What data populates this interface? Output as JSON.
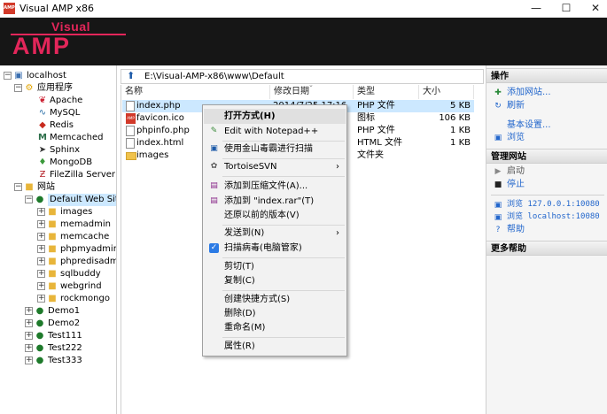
{
  "window": {
    "title": "Visual AMP x86",
    "app_icon_text": "AMP",
    "min": "—",
    "max": "☐",
    "close": "✕"
  },
  "banner": {
    "logo_top": "Visual",
    "logo_main": "AMP"
  },
  "tree": {
    "root": "localhost",
    "apps_label": "应用程序",
    "apps": [
      "Apache",
      "MySQL",
      "Redis",
      "Memcached",
      "Sphinx",
      "MongoDB",
      "FileZilla Server"
    ],
    "sites_label": "网站",
    "default_site": "Default Web Site",
    "default_children": [
      "images",
      "memadmin",
      "memcache",
      "phpmyadmin",
      "phpredisadmin",
      "sqlbuddy",
      "webgrind",
      "rockmongo"
    ],
    "other_sites": [
      "Demo1",
      "Demo2",
      "Test111",
      "Test222",
      "Test333"
    ]
  },
  "path": {
    "value": "E:\\Visual-AMP-x86\\www\\Default"
  },
  "columns": {
    "name": "名称",
    "modified": "修改日期",
    "type": "类型",
    "size": "大小"
  },
  "files": [
    {
      "name": "index.php",
      "date": "2014/7/25 17:16",
      "type": "PHP 文件",
      "size": "5 KB"
    },
    {
      "name": "favicon.ico",
      "date": "",
      "type": "图标",
      "size": "106 KB"
    },
    {
      "name": "phpinfo.php",
      "date": "",
      "type": "PHP 文件",
      "size": "1 KB"
    },
    {
      "name": "index.html",
      "date": "",
      "type": "HTML 文件",
      "size": "1 KB"
    },
    {
      "name": "images",
      "date": "",
      "type": "文件夹",
      "size": ""
    }
  ],
  "context_menu": {
    "open": "打开方式(H)",
    "notepad": "Edit with Notepad++",
    "scan": "使用金山毒霸进行扫描",
    "svn": "TortoiseSVN",
    "add_archive": "添加到压缩文件(A)...",
    "add_rar": "添加到 \"index.rar\"(T)",
    "restore": "还原以前的版本(V)",
    "sendto": "发送到(N)",
    "virus": "扫描病毒(电脑管家)",
    "cut": "剪切(T)",
    "copy": "复制(C)",
    "shortcut": "创建快捷方式(S)",
    "delete": "删除(D)",
    "rename": "重命名(M)",
    "properties": "属性(R)"
  },
  "right": {
    "ops_title": "操作",
    "add_site": "添加网站...",
    "refresh": "刷新",
    "basic_settings": "基本设置...",
    "browse": "浏览",
    "manage_title": "管理网站",
    "start": "启动",
    "stop": "停止",
    "browse_ip": "浏览 127.0.0.1:10080",
    "browse_local": "浏览 localhost:10080",
    "help": "帮助",
    "more_title": "更多帮助"
  },
  "colors": {
    "accent": "#e3265a",
    "banner_bg": "#161616",
    "selection": "#cce8ff",
    "link": "#2266cc"
  }
}
